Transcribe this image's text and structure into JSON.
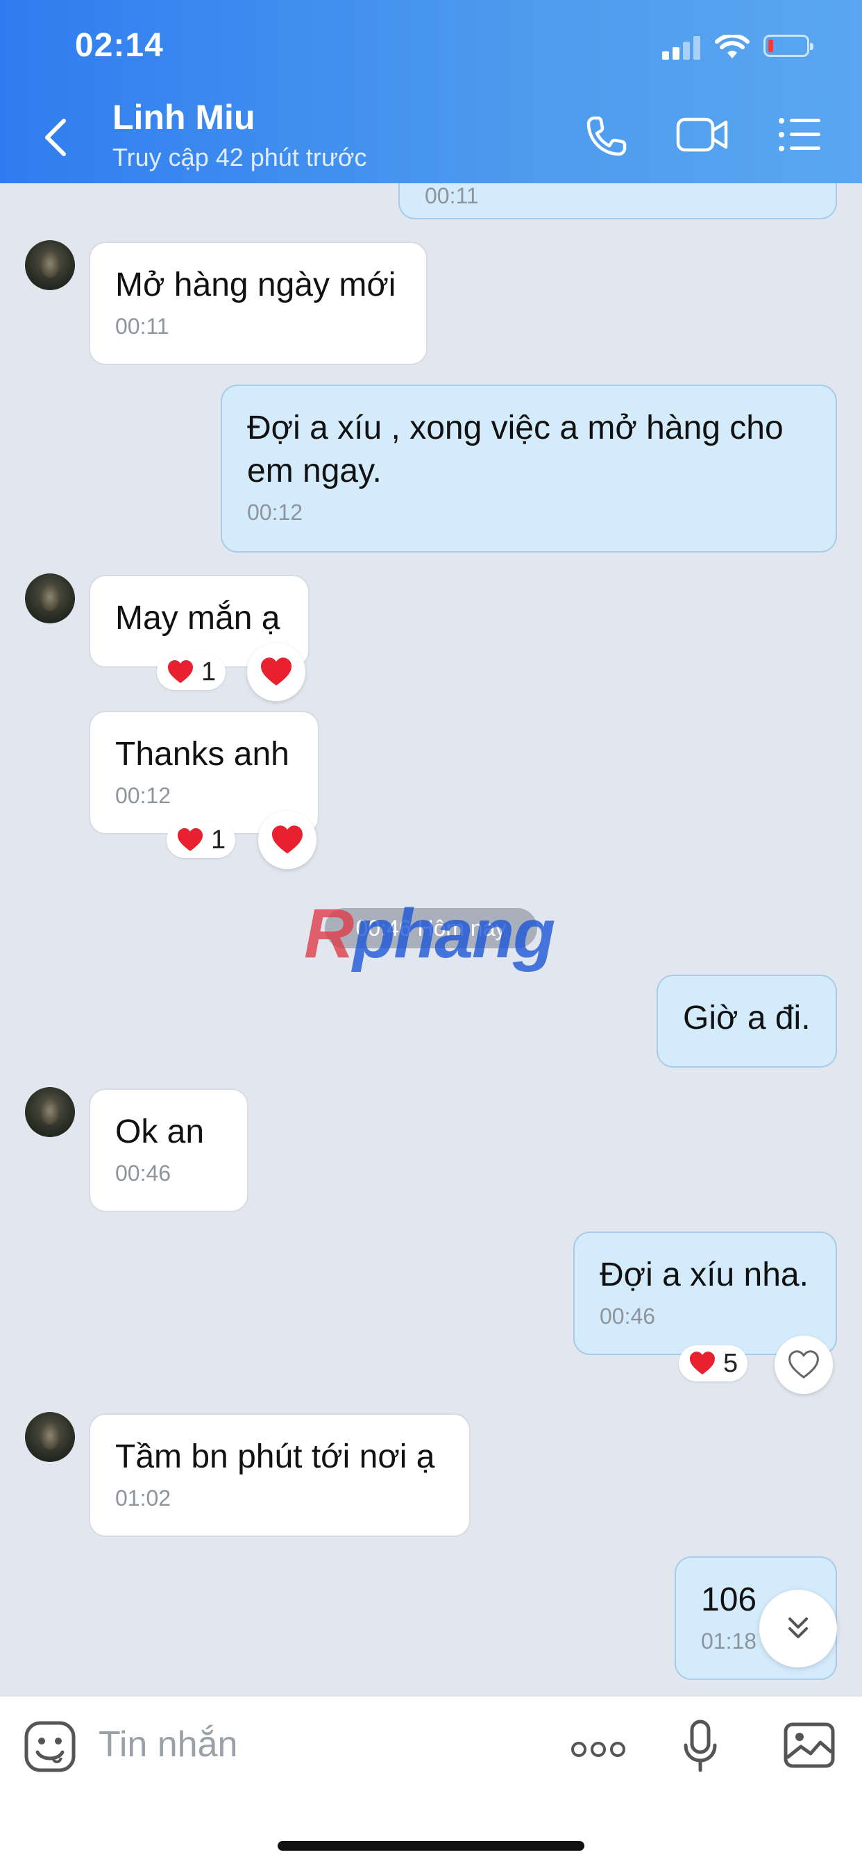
{
  "status_bar": {
    "time": "02:14"
  },
  "header": {
    "contact_name": "Linh Miu",
    "status": "Truy cập 42 phút trước"
  },
  "messages": {
    "top_partial": {
      "time": "00:11"
    },
    "m1": {
      "text": "Mở hàng ngày mới",
      "time": "00:11"
    },
    "m2": {
      "text": "Đợi a xíu , xong việc a mở hàng cho em ngay.",
      "time": "00:12"
    },
    "m3": {
      "text": "May mắn ạ",
      "reaction_count": "1"
    },
    "m4": {
      "text": "Thanks anh",
      "time": "00:12",
      "reaction_count": "1"
    },
    "date_divider": "00:46 Hôm nay",
    "m5": {
      "text": "Giờ a đi."
    },
    "m6": {
      "text": "Ok an",
      "time": "00:46"
    },
    "m7": {
      "text": "Đợi a xíu nha.",
      "time": "00:46",
      "reaction_count": "5"
    },
    "m8": {
      "text": "Tầm bn phút tới nơi ạ",
      "time": "01:02"
    },
    "m9": {
      "text": "106",
      "time": "01:18"
    }
  },
  "watermark": {
    "part1": "R",
    "part2": "phang"
  },
  "composer": {
    "placeholder": "Tin nhắn"
  },
  "colors": {
    "header_start": "#2f7cf0",
    "header_end": "#5aa6f0",
    "out_bubble": "#d4ebfc",
    "in_bubble": "#ffffff",
    "chat_bg": "#e2e6ef",
    "reaction_heart": "#e8202f"
  }
}
